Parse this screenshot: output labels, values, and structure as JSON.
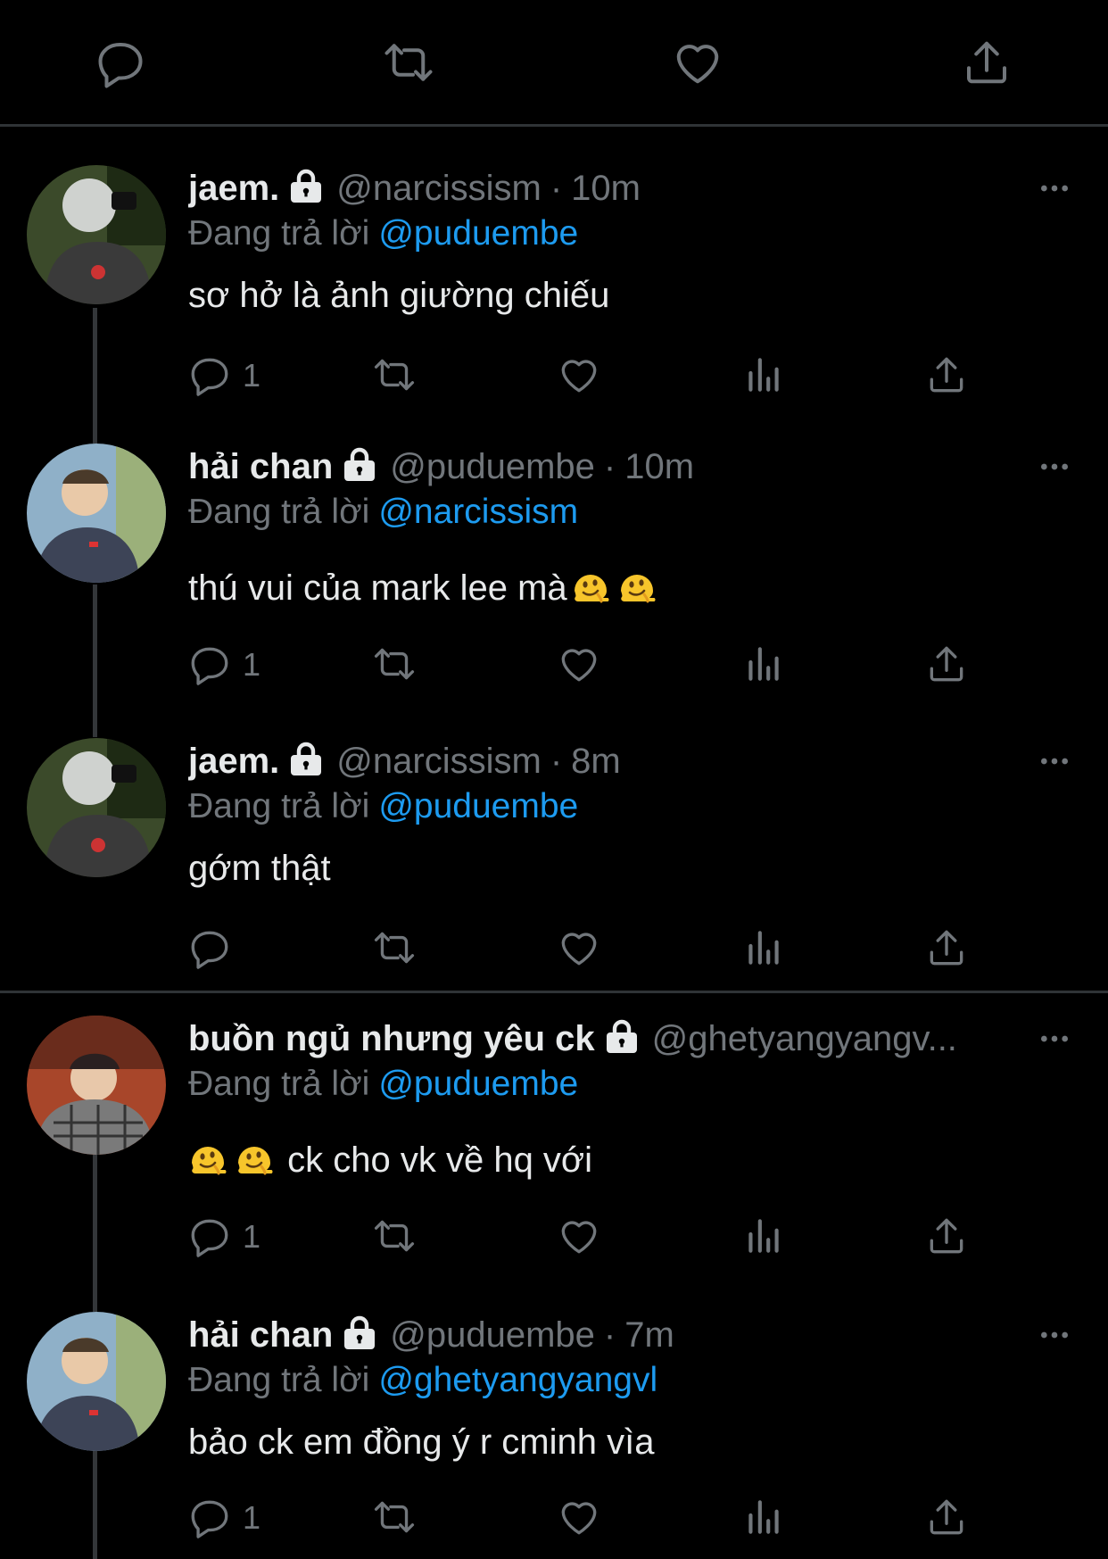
{
  "top_actions": [
    "reply-icon",
    "retweet-icon",
    "like-icon",
    "share-icon"
  ],
  "colors": {
    "background": "#000000",
    "text": "#e7e9ea",
    "muted": "#71767b",
    "link": "#1d9bf0"
  },
  "tweets": [
    {
      "name": "jaem.",
      "handle": "@narcissism",
      "separator": "·",
      "time": "10m",
      "replying_label": "Đang trả lời",
      "replying_to": "@puduembe",
      "text": "sơ hở là ảnh giường chiếu",
      "reply_count": "1"
    },
    {
      "name": "hải chan",
      "handle": "@puduembe",
      "separator": "·",
      "time": "10m",
      "replying_label": "Đang trả lời",
      "replying_to": "@narcissism",
      "text": "thú vui của mark lee mà",
      "reply_count": "1"
    },
    {
      "name": "jaem.",
      "handle": "@narcissism",
      "separator": "·",
      "time": "8m",
      "replying_label": "Đang trả lời",
      "replying_to": "@puduembe",
      "text": "gớm thật",
      "reply_count": ""
    },
    {
      "name": "buồn ngủ nhưng yêu ck",
      "handle": "@ghetyangyangv...",
      "separator": "",
      "time": "",
      "replying_label": "Đang trả lời",
      "replying_to": "@puduembe",
      "text": "ck cho vk về hq với",
      "reply_count": "1"
    },
    {
      "name": "hải chan",
      "handle": "@puduembe",
      "separator": "·",
      "time": "7m",
      "replying_label": "Đang trả lời",
      "replying_to": "@ghetyangyangvl",
      "text": "bảo ck em đồng ý r cminh vìa",
      "reply_count": "1"
    }
  ]
}
